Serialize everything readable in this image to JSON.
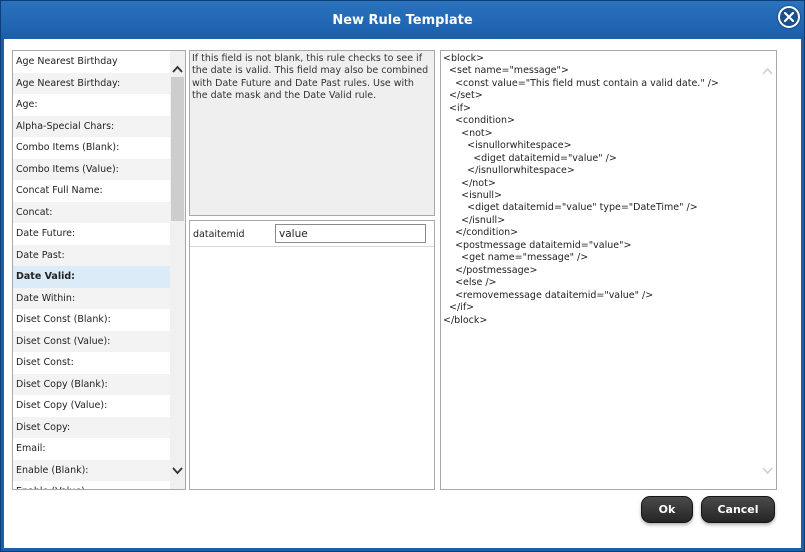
{
  "dialog": {
    "title": "New Rule Template",
    "close_icon": "close-icon"
  },
  "rules_list": {
    "items": [
      {
        "label": "Age Nearest Birthday"
      },
      {
        "label": "Age Nearest Birthday:"
      },
      {
        "label": "Age:"
      },
      {
        "label": "Alpha-Special Chars:"
      },
      {
        "label": "Combo Items (Blank):"
      },
      {
        "label": "Combo Items (Value):"
      },
      {
        "label": "Concat Full Name:"
      },
      {
        "label": "Concat:"
      },
      {
        "label": "Date Future:"
      },
      {
        "label": "Date Past:"
      },
      {
        "label": "Date Valid:"
      },
      {
        "label": "Date Within:"
      },
      {
        "label": "Diset Const (Blank):"
      },
      {
        "label": "Diset Const (Value):"
      },
      {
        "label": "Diset Const:"
      },
      {
        "label": "Diset Copy (Blank):"
      },
      {
        "label": "Diset Copy (Value):"
      },
      {
        "label": "Diset Copy:"
      },
      {
        "label": "Email:"
      },
      {
        "label": "Enable (Blank):"
      },
      {
        "label": "Enable (Value):"
      }
    ],
    "selected": "Date Valid:",
    "scroll_up_icon": "chevron-up-icon",
    "scroll_down_icon": "chevron-down-icon"
  },
  "description": {
    "text": "If this field is not blank, this rule checks to see if the date is valid. This field may also be combined with Date Future and Date Past rules. Use with the date mask and the Date Valid rule."
  },
  "parameters": [
    {
      "name": "dataitemid",
      "value": "value"
    }
  ],
  "xml": {
    "code": "<block>\n  <set name=\"message\">\n    <const value=\"This field must contain a valid date.\" />\n  </set>\n  <if>\n    <condition>\n      <not>\n        <isnullorwhitespace>\n          <diget dataitemid=\"value\" />\n        </isnullorwhitespace>\n      </not>\n      <isnull>\n        <diget dataitemid=\"value\" type=\"DateTime\" />\n      </isnull>\n    </condition>\n    <postmessage dataitemid=\"value\">\n      <get name=\"message\" />\n    </postmessage>\n    <else />\n    <removemessage dataitemid=\"value\" />\n  </if>\n</block>"
  },
  "buttons": {
    "ok_label": "Ok",
    "cancel_label": "Cancel"
  },
  "colors": {
    "title_bar": "#1b5fa8",
    "selected_row": "#dcebf8",
    "button": "#333333"
  }
}
